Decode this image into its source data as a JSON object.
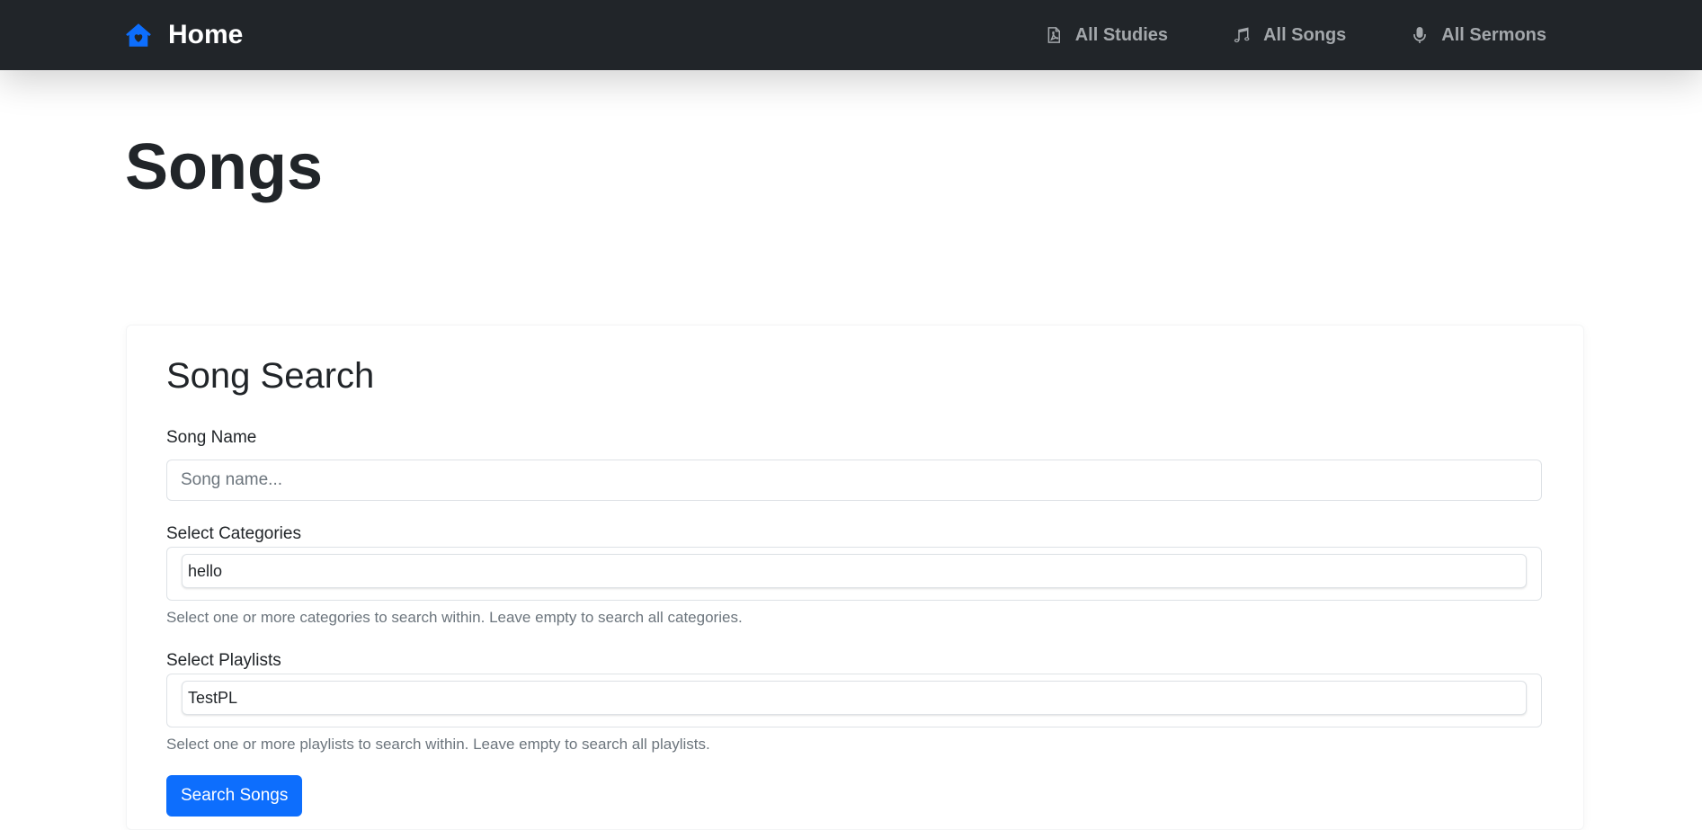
{
  "navbar": {
    "brand": {
      "label": "Home",
      "icon": "house-heart-icon",
      "icon_color": "#0d6efd"
    },
    "links": [
      {
        "label": "All Studies",
        "icon": "file-pdf-icon"
      },
      {
        "label": "All Songs",
        "icon": "music-note-icon"
      },
      {
        "label": "All Sermons",
        "icon": "mic-icon"
      }
    ]
  },
  "page": {
    "title": "Songs"
  },
  "search_card": {
    "title": "Song Search",
    "song_name": {
      "label": "Song Name",
      "placeholder": "Song name...",
      "value": ""
    },
    "categories": {
      "label": "Select Categories",
      "selected": [
        "hello"
      ],
      "help": "Select one or more categories to search within. Leave empty to search all categories."
    },
    "playlists": {
      "label": "Select Playlists",
      "selected": [
        "TestPL"
      ],
      "help": "Select one or more playlists to search within. Leave empty to search all playlists."
    },
    "submit_label": "Search Songs"
  },
  "colors": {
    "navbar_bg": "#212529",
    "accent": "#0d6efd",
    "nav_text": "#a3a7ab"
  }
}
